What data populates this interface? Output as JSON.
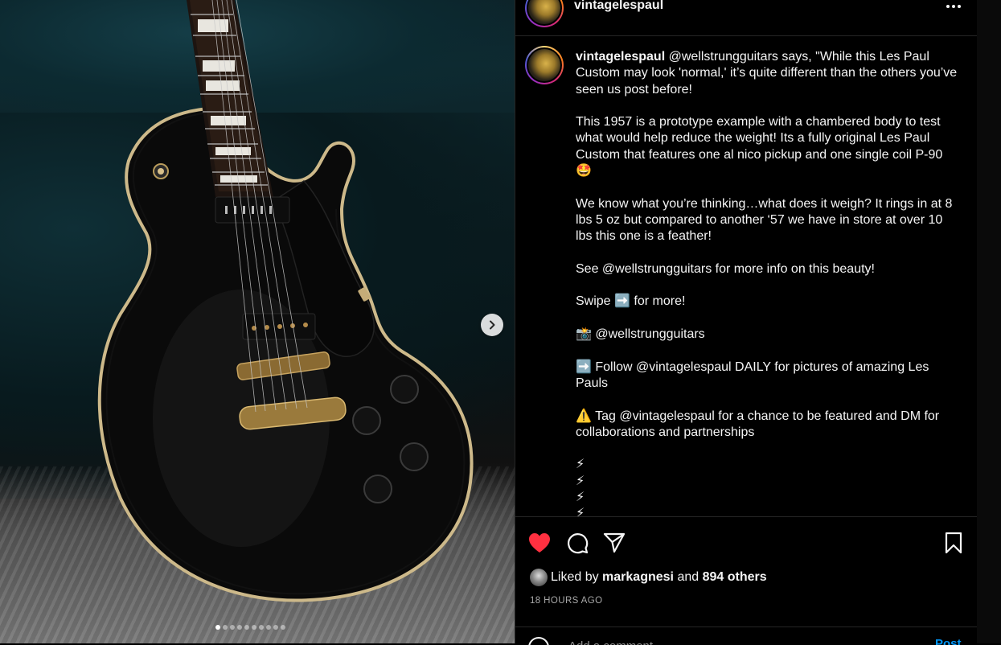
{
  "post": {
    "username": "vintagelespaul",
    "more_icon": "more-horizontal-icon",
    "media_count": 10,
    "active_media_index": 0
  },
  "caption": {
    "username": "vintagelespaul",
    "text": " @wellstrungguitars says, \"While this Les Paul Custom may look 'normal,' it’s quite different than the others you’ve seen us post before!\n\nThis 1957 is a prototype example with a chambered body to test what would help reduce the weight! Its a fully original Les Paul Custom that features one al nico pickup and one single coil P-90 🤩\n\nWe know what you’re thinking…what does it weigh? It rings in at 8 lbs 5 oz but compared to another ‘57 we have in store at over 10 lbs this one is a feather!\n\nSee @wellstrungguitars for more info on this beauty!\n\nSwipe ➡️ for more!\n\n📸 @wellstrungguitars\n\n➡️ Follow @vintagelespaul DAILY for pictures of amazing Les Pauls\n\n⚠️ Tag @vintagelespaul for a chance to be featured and DM for collaborations and partnerships\n\n⚡\n⚡\n⚡\n⚡"
  },
  "actions": {
    "like_icon": "heart-filled-icon",
    "comment_icon": "comment-icon",
    "share_icon": "share-icon",
    "save_icon": "bookmark-icon",
    "like_color": "#ff3040"
  },
  "likes": {
    "prefix": "Liked by",
    "first_liker": "markagnesi",
    "joiner": "and",
    "others": "894 others"
  },
  "timestamp": "18 HOURS AGO",
  "comment_bar": {
    "placeholder": "Add a comment...",
    "post_label": "Post"
  }
}
